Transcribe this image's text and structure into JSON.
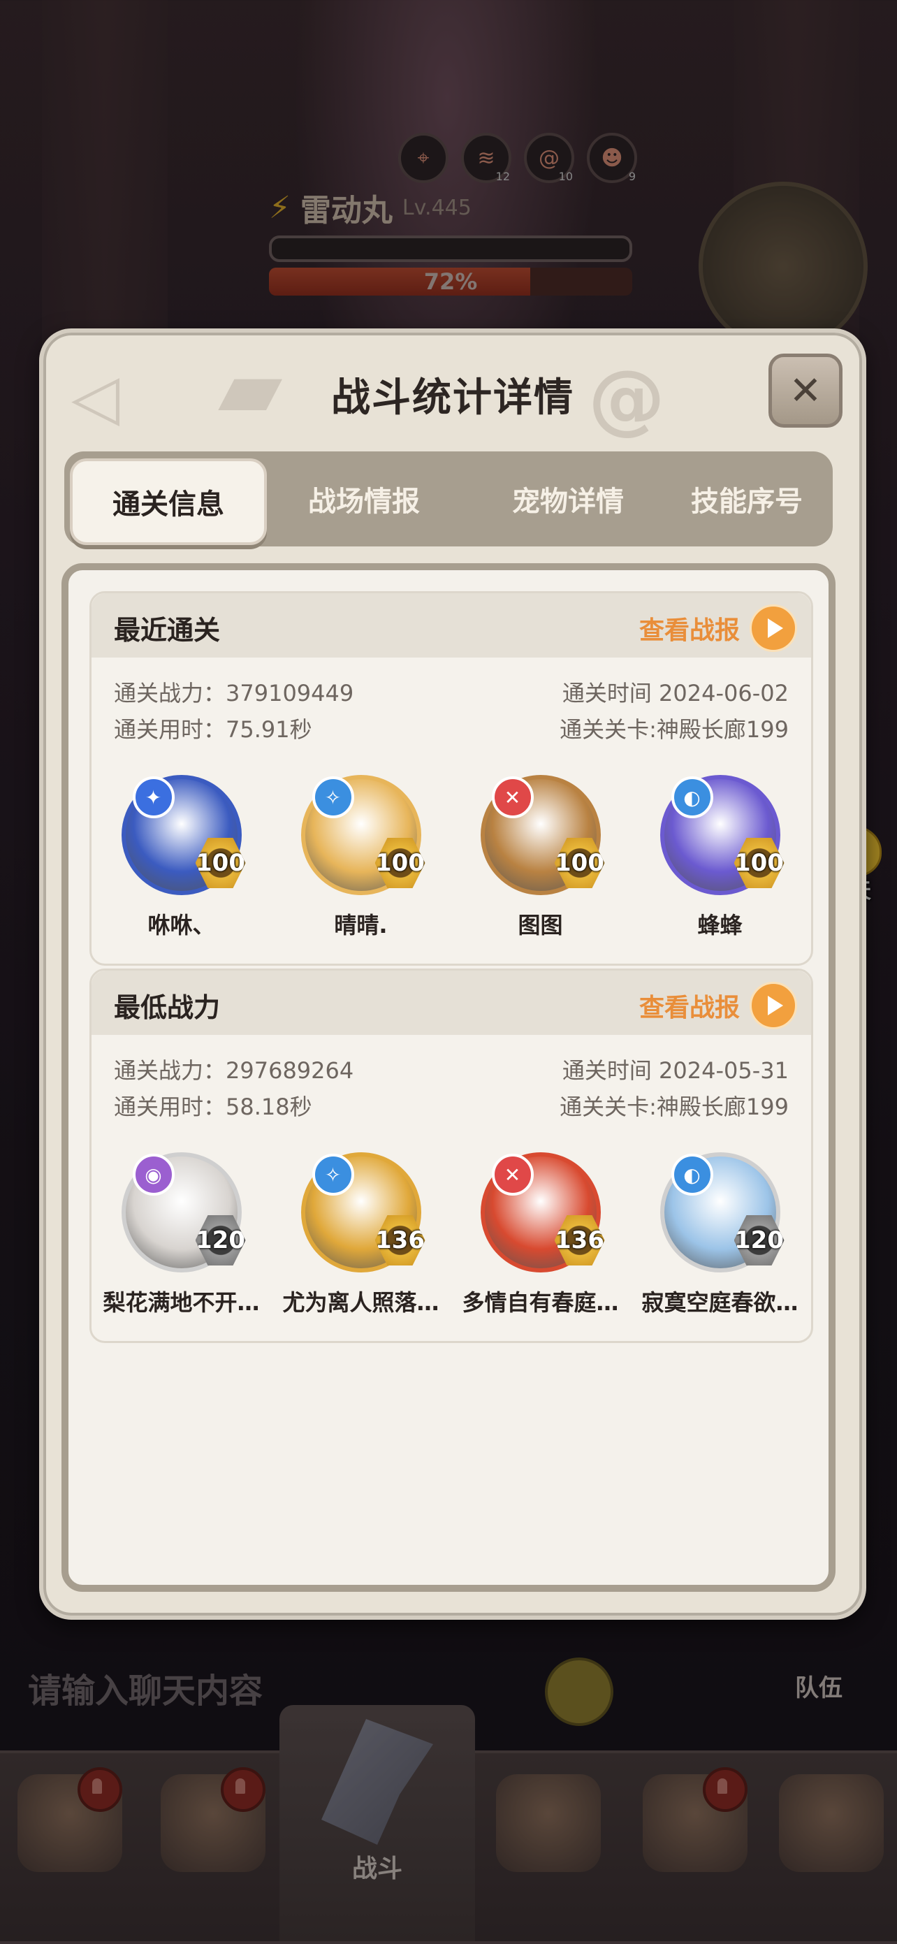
{
  "background": {
    "boss": {
      "name": "雷动丸",
      "level": "Lv.445",
      "hp_fraction": 0.72,
      "hp_label": "72%"
    },
    "buffs": [
      {
        "icon": "crosshair-icon",
        "count": ""
      },
      {
        "icon": "claw-icon",
        "count": "12"
      },
      {
        "icon": "swirl-icon",
        "count": "10"
      },
      {
        "icon": "face-icon",
        "count": "9"
      }
    ],
    "chat_placeholder": "请输入聊天内容",
    "side_chat_label": "聊天",
    "team_label": "队伍",
    "nav_fight_label": "战斗"
  },
  "modal": {
    "title": "战斗统计详情",
    "close_label": "✕",
    "tabs": [
      {
        "label": "通关信息",
        "active": true
      },
      {
        "label": "战场情报",
        "active": false
      },
      {
        "label": "宠物详情",
        "active": false
      },
      {
        "label": "技能序号",
        "active": false
      }
    ],
    "sections": [
      {
        "title": "最近通关",
        "view_report": "查看战报",
        "power_label": "通关战力：379109449",
        "duration_label": "通关用时：75.91秒",
        "time_label": "通关时间  2024-06-02",
        "stage_label": "通关关卡:神殿长廊199",
        "pets": [
          {
            "name": "咻咻、",
            "level": "100",
            "badge": "✦",
            "badge_color": "#3b6fe0",
            "avatar_color": "#3b5bc0",
            "level_style": "gold"
          },
          {
            "name": "晴晴.",
            "level": "100",
            "badge": "✧",
            "badge_color": "#3b8fe0",
            "avatar_color": "#e7b55a",
            "level_style": "gold"
          },
          {
            "name": "图图",
            "level": "100",
            "badge": "✕",
            "badge_color": "#e04848",
            "avatar_color": "#b98242",
            "level_style": "gold"
          },
          {
            "name": "蜂蜂",
            "level": "100",
            "badge": "◐",
            "badge_color": "#3b8fe0",
            "avatar_color": "#6b5ad0",
            "level_style": "gold"
          }
        ]
      },
      {
        "title": "最低战力",
        "view_report": "查看战报",
        "power_label": "通关战力：297689264",
        "duration_label": "通关用时：58.18秒",
        "time_label": "通关时间  2024-05-31",
        "stage_label": "通关关卡:神殿长廊199",
        "pets": [
          {
            "name": "梨花满地不开…",
            "level": "120",
            "badge": "◉",
            "badge_color": "#9b5fd0",
            "avatar_color": "#d8d4d0",
            "level_style": "grey"
          },
          {
            "name": "尤为离人照落…",
            "level": "136",
            "badge": "✧",
            "badge_color": "#3b8fe0",
            "avatar_color": "#e0a83a",
            "level_style": "gold"
          },
          {
            "name": "多情自有春庭…",
            "level": "136",
            "badge": "✕",
            "badge_color": "#e04848",
            "avatar_color": "#d84a30",
            "level_style": "gold"
          },
          {
            "name": "寂寞空庭春欲…",
            "level": "120",
            "badge": "◐",
            "badge_color": "#3b8fe0",
            "avatar_color": "#9cc4e8",
            "level_style": "grey"
          }
        ]
      }
    ]
  }
}
